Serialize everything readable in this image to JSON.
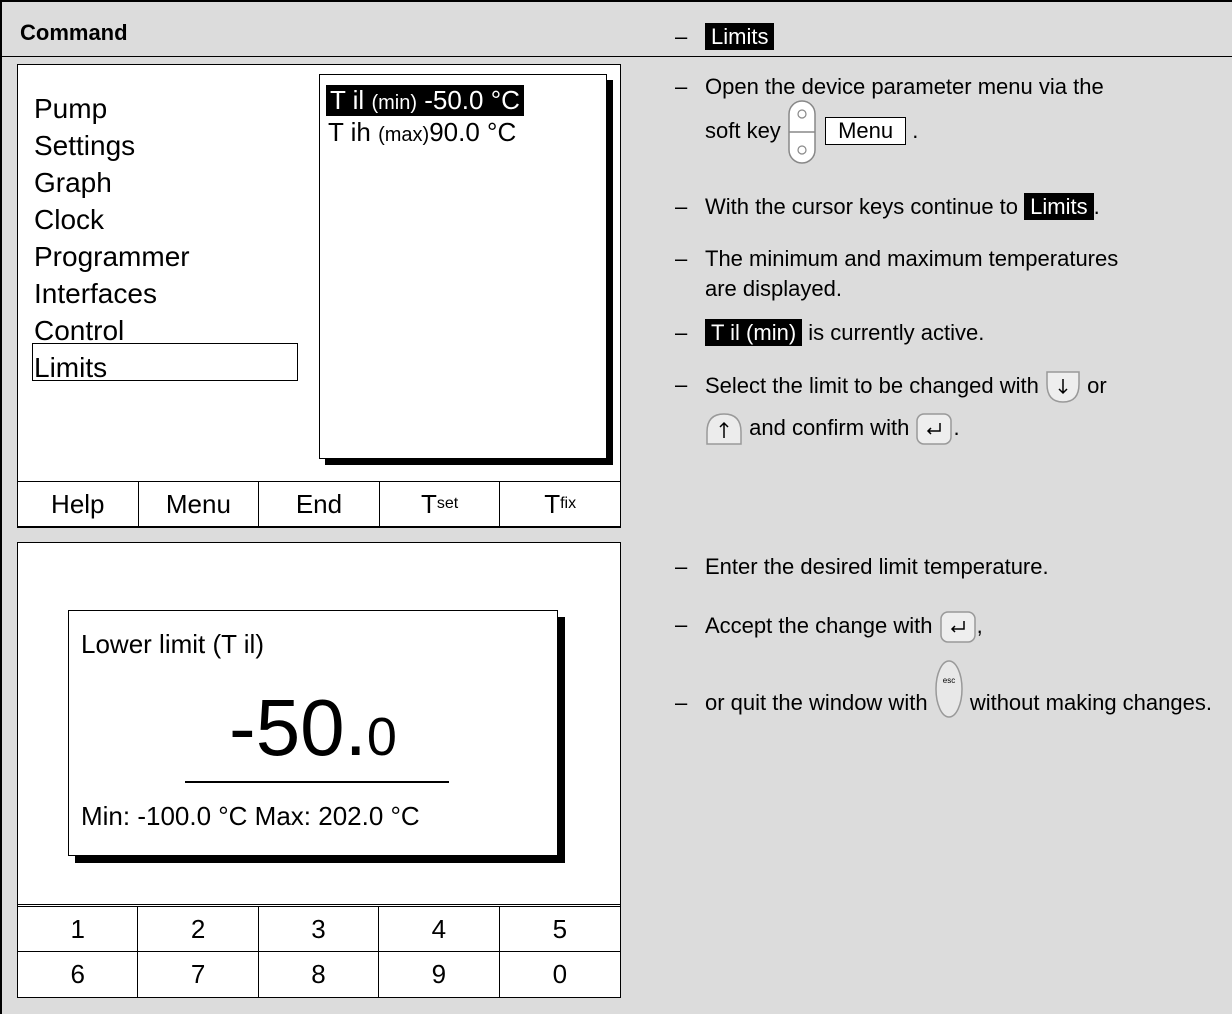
{
  "header": {
    "command": "Command"
  },
  "menu": {
    "items": [
      "Pump",
      "Settings",
      "Graph",
      "Clock",
      "Programmer",
      "Interfaces",
      "Control",
      "Limits"
    ],
    "selected": "Limits"
  },
  "popup": {
    "row1": {
      "name": "T il",
      "qual": "(min)",
      "value": "-50.0 °C"
    },
    "row2": {
      "name": "T ih",
      "qual": "(max)",
      "value": "90.0 °C"
    }
  },
  "softkeys": {
    "help": "Help",
    "menu": "Menu",
    "end": "End",
    "tset_base": "T",
    "tset_sub": "set",
    "tfix_base": "T",
    "tfix_sub": "fix"
  },
  "dialog": {
    "title": "Lower limit (T il)",
    "value_int": "-50.",
    "value_dec": "0",
    "range": "Min: -100.0 °C   Max: 202.0 °C"
  },
  "numpad": [
    "1",
    "2",
    "3",
    "4",
    "5",
    "6",
    "7",
    "8",
    "9",
    "0"
  ],
  "instructions": {
    "s1_badge": "Limits",
    "s2_text": "Open the device parameter menu via the",
    "s2_soft": "soft key",
    "s2_menu": "Menu",
    "s3_text": "With the cursor keys continue to",
    "s3_badge": "Limits",
    "s4_text": "The minimum and maximum temperatures are displayed.",
    "s5_badge": "T il (min)",
    "s5_text": "is currently active.",
    "s6_text": "Select the limit to be changed with",
    "s6_or": "or",
    "s6_confirm": "and confirm with",
    "s7_text": "Enter the desired limit temperature.",
    "s8_text": "Accept the change with",
    "s9_text1": "or quit the window with",
    "s9_text2": "without making changes."
  }
}
